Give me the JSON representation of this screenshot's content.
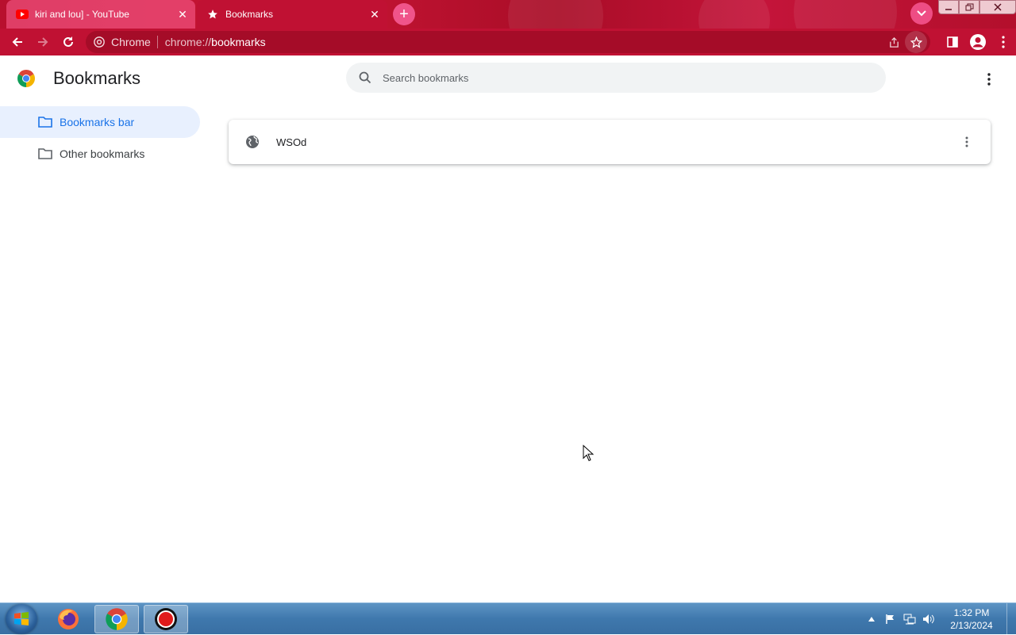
{
  "browser": {
    "tabs": [
      {
        "title": "kiri and lou] - YouTube",
        "favicon": "youtube-icon",
        "active": false
      },
      {
        "title": "Bookmarks",
        "favicon": "star-icon",
        "active": true
      }
    ],
    "omnibox": {
      "site_label": "Chrome",
      "url_scheme": "chrome://",
      "url_path": "bookmarks"
    },
    "theme_color": "#c01133"
  },
  "page": {
    "title": "Bookmarks",
    "search_placeholder": "Search bookmarks",
    "sidebar": [
      {
        "label": "Bookmarks bar",
        "selected": true
      },
      {
        "label": "Other bookmarks",
        "selected": false
      }
    ],
    "bookmarks": [
      {
        "title": "WSOd",
        "icon": "globe-icon"
      }
    ]
  },
  "taskbar": {
    "apps": [
      "firefox-icon",
      "chrome-icon",
      "record-icon"
    ],
    "clock": {
      "time": "1:32 PM",
      "date": "2/13/2024"
    }
  }
}
